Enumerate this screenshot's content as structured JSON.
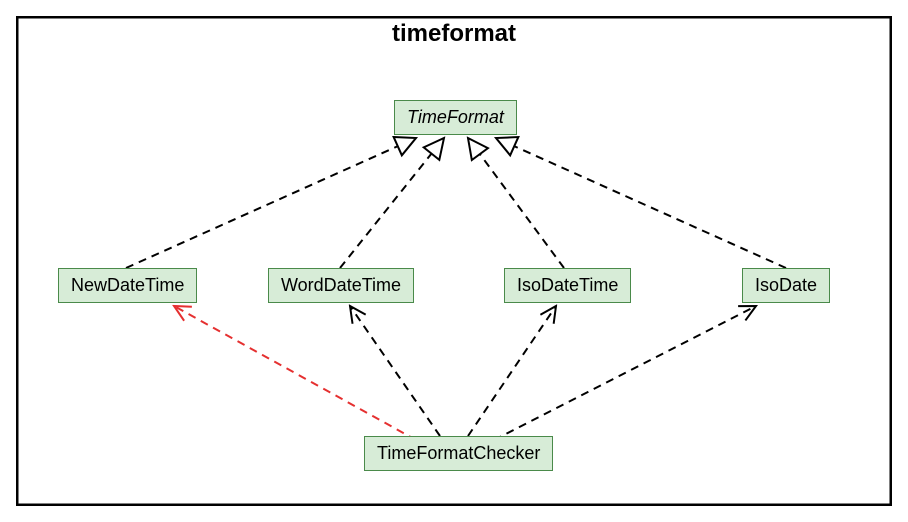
{
  "diagram": {
    "title": "timeformat",
    "nodes": {
      "timeFormat": "TimeFormat",
      "newDateTime": "NewDateTime",
      "wordDateTime": "WordDateTime",
      "isoDateTime": "IsoDateTime",
      "isoDate": "IsoDate",
      "timeFormatChecker": "TimeFormatChecker"
    },
    "edges": [
      {
        "from": "NewDateTime",
        "to": "TimeFormat",
        "type": "realization"
      },
      {
        "from": "WordDateTime",
        "to": "TimeFormat",
        "type": "realization"
      },
      {
        "from": "IsoDateTime",
        "to": "TimeFormat",
        "type": "realization"
      },
      {
        "from": "IsoDate",
        "to": "TimeFormat",
        "type": "realization"
      },
      {
        "from": "TimeFormatChecker",
        "to": "NewDateTime",
        "type": "dependency",
        "color": "red"
      },
      {
        "from": "TimeFormatChecker",
        "to": "WordDateTime",
        "type": "dependency"
      },
      {
        "from": "TimeFormatChecker",
        "to": "IsoDateTime",
        "type": "dependency"
      },
      {
        "from": "TimeFormatChecker",
        "to": "IsoDate",
        "type": "dependency"
      }
    ]
  }
}
